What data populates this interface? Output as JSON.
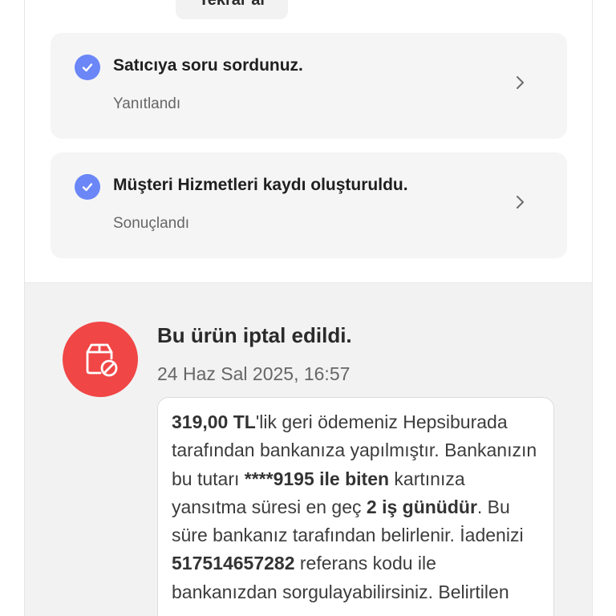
{
  "retry_button": {
    "label": "Tekrar al"
  },
  "steps": [
    {
      "title": "Satıcıya soru sordunuz.",
      "status": "Yanıtlandı",
      "icon": "check-circle-icon"
    },
    {
      "title": "Müşteri Hizmetleri kaydı oluşturuldu.",
      "status": "Sonuçlandı",
      "icon": "check-circle-icon"
    }
  ],
  "cancellation": {
    "icon": "cancelled-package-icon",
    "title": "Bu ürün iptal edildi.",
    "date": "24 Haz Sal 2025, 16:57",
    "refund": {
      "amount": "319,00 TL",
      "text_1": "'lik geri ödemeniz Hepsiburada tarafından bankanıza yapılmıştır. Bankanızın bu tutarı ",
      "card": "****9195 ile biten",
      "text_2": " kartınıza yansıtma süresi en geç ",
      "duration": "2 iş günüdür",
      "text_3": ". Bu süre bankanız tarafından belirlenir. İadenizi ",
      "reference": "517514657282",
      "text_4": " referans kodu ile bankanızdan sorgulayabilirsiniz. Belirtilen"
    }
  },
  "colors": {
    "check_blue": "#6a86f7",
    "cancel_red": "#f04646",
    "card_bg": "#f5f5f5",
    "section_bg": "#f2f2f2"
  }
}
